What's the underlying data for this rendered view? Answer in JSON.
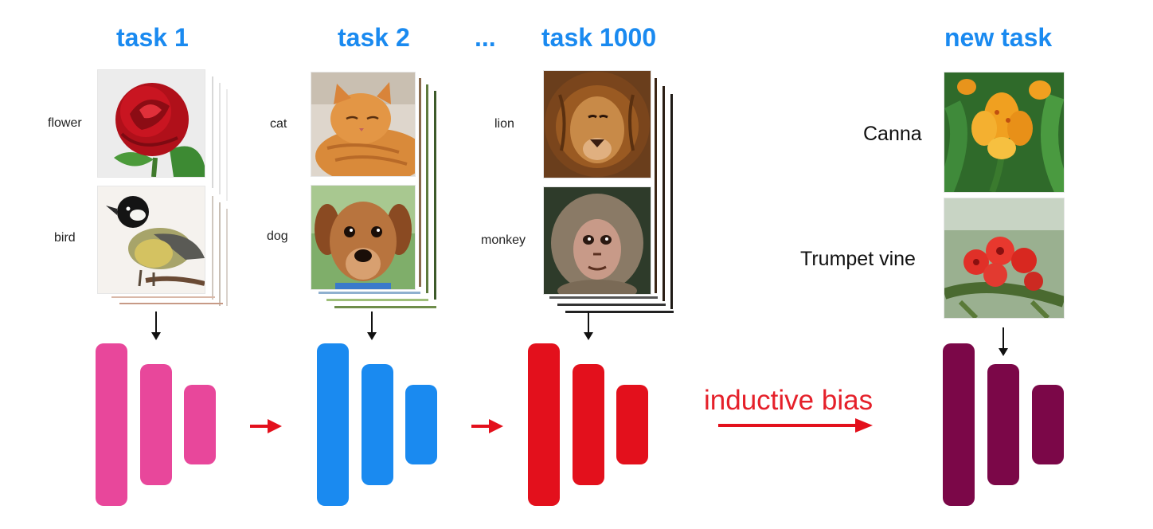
{
  "tasks": [
    {
      "title": "task 1",
      "labels": [
        "flower",
        "bird"
      ],
      "images": [
        "rose-photo",
        "bird-photo"
      ],
      "color": "#e8479b"
    },
    {
      "title": "task 2",
      "labels": [
        "cat",
        "dog"
      ],
      "images": [
        "cat-photo",
        "dog-photo"
      ],
      "color": "#1a8af0"
    },
    {
      "title": "task 1000",
      "labels": [
        "lion",
        "monkey"
      ],
      "images": [
        "lion-photo",
        "monkey-photo"
      ],
      "color": "#e3101c"
    }
  ],
  "ellipsis": "...",
  "new_task": {
    "title": "new task",
    "labels": [
      "Canna",
      "Trumpet vine"
    ],
    "images": [
      "canna-photo",
      "trumpet-vine-photo"
    ],
    "color": "#7b0748"
  },
  "inductive_bias": "inductive bias",
  "colors": {
    "title": "#1a8af0",
    "arrow_red": "#e3101c",
    "arrow_black": "#111111"
  }
}
